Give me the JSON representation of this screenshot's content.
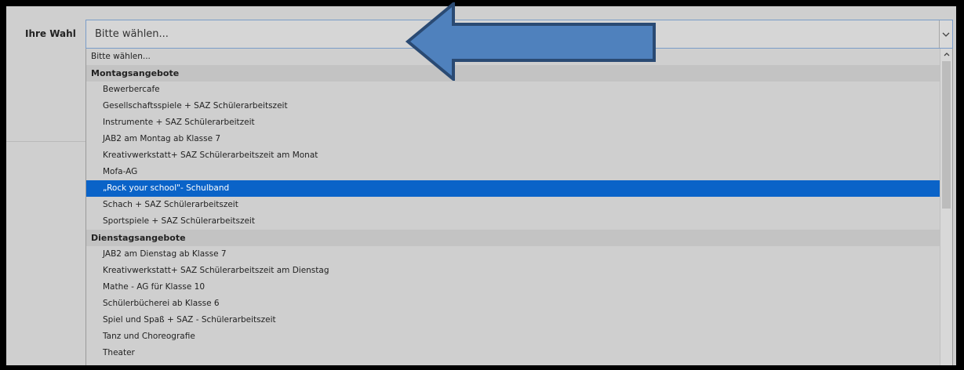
{
  "form": {
    "label": "Ihre Wahl",
    "select_value": "Bitte wählen..."
  },
  "dropdown": {
    "placeholder_option": "Bitte wählen...",
    "groups": [
      {
        "label": "Montagsangebote",
        "options": [
          "Bewerbercafe",
          "Gesellschaftsspiele + SAZ Schülerarbeitszeit",
          "Instrumente + SAZ Schülerarbeitzeit",
          "JAB2 am Montag ab Klasse 7",
          "Kreativwerkstatt+ SAZ Schülerarbeitszeit am Monat",
          "Mofa-AG",
          "„Rock your school\"- Schulband",
          "Schach + SAZ Schülerarbeitszeit",
          "Sportspiele + SAZ Schülerarbeitszeit"
        ]
      },
      {
        "label": "Dienstagsangebote",
        "options": [
          "JAB2 am Dienstag ab Klasse 7",
          "Kreativwerkstatt+ SAZ Schülerarbeitszeit am Dienstag",
          "Mathe - AG für Klasse 10",
          "Schülerbücherei ab Klasse 6",
          "Spiel und Spaß + SAZ - Schülerarbeitszeit",
          "Tanz und Choreografie",
          "Theater"
        ]
      }
    ],
    "selected_option": "„Rock your school\"- Schulband"
  },
  "icons": {
    "caret": "chevron-down-icon",
    "scroll_up": "chevron-up-icon",
    "annotation": "left-arrow-icon"
  },
  "colors": {
    "selected_bg": "#0a63c8",
    "arrow_fill": "#4f81bd",
    "arrow_stroke": "#2a4a73"
  }
}
